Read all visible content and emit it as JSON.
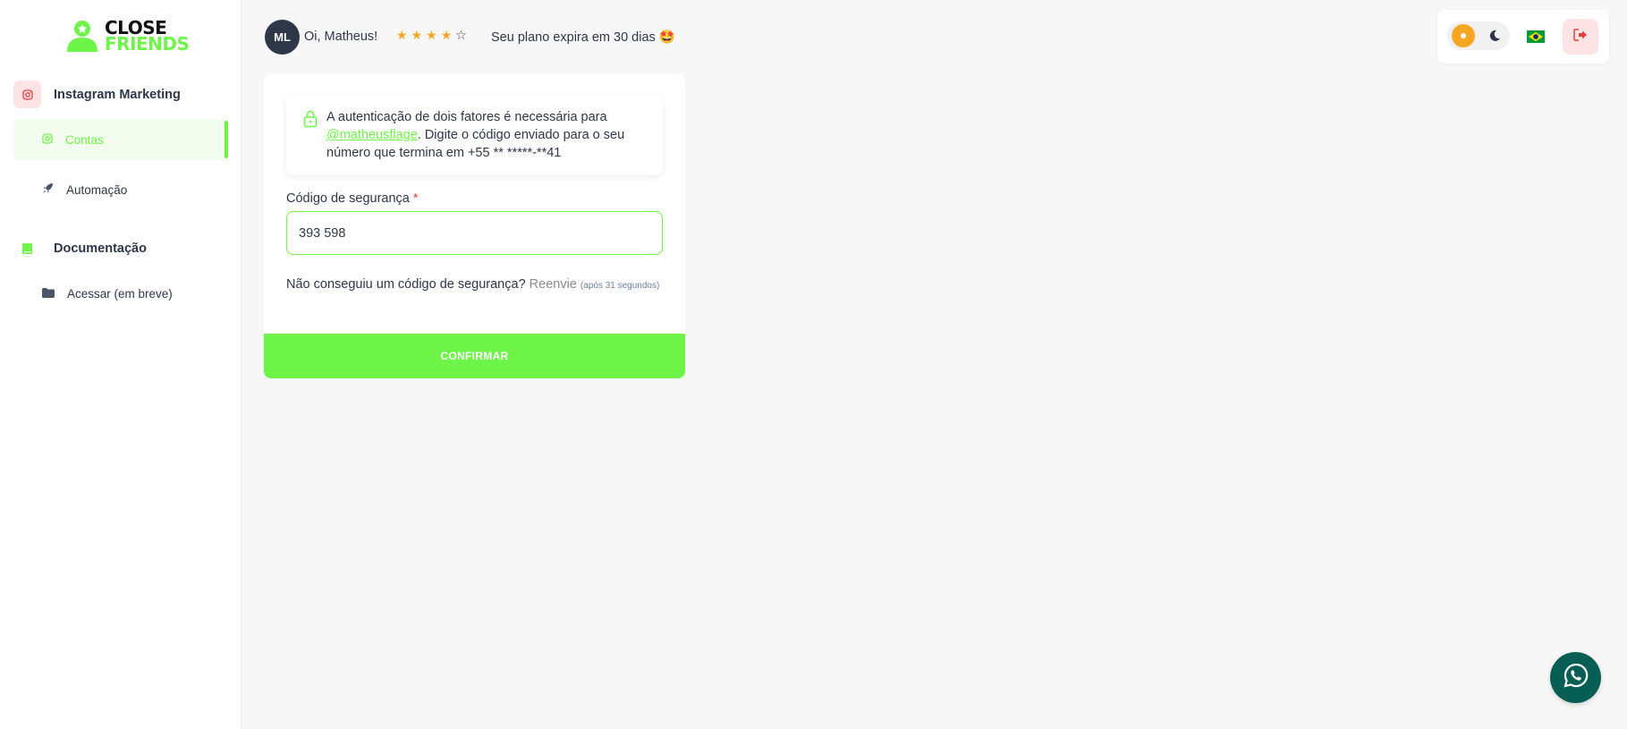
{
  "logo": {
    "line1": "CLOSE",
    "line2": "FRIENDS"
  },
  "sidebar": {
    "sections": [
      {
        "label": "Instagram Marketing",
        "icon": "instagram-icon",
        "color": "#e53e3e"
      },
      {
        "label": "Documentação",
        "icon": "book-icon",
        "color": "#6ff54a"
      }
    ],
    "items": [
      {
        "label": "Contas",
        "icon": "instagram-icon",
        "active": true
      },
      {
        "label": "Automação",
        "icon": "rocket-icon",
        "active": false
      },
      {
        "label": "Acessar (em breve)",
        "icon": "folder-icon",
        "active": false
      }
    ]
  },
  "header": {
    "avatar_initials": "ML",
    "greeting": "Oi, Matheus!",
    "rating": {
      "filled": 4,
      "total": 5
    },
    "plan_text": "Seu plano expira em 30 dias 🤩"
  },
  "top_controls": {
    "theme": "light",
    "icons": [
      "sun-icon",
      "moon-icon",
      "brazil-flag-icon",
      "logout-icon"
    ]
  },
  "two_factor": {
    "alert_prefix": "A autenticação de dois fatores é necessária para ",
    "handle": "@matheusflage",
    "alert_suffix": ". Digite o código enviado para o seu número que termina em +55 ** *****-**41",
    "field_label": "Código de segurança",
    "required_mark": "*",
    "code_value": "393 598",
    "resend_question": "Não conseguiu um código de segurança?",
    "resend_link": "Reenvie",
    "resend_timer": "(após 31 segundos)",
    "confirm_label": "CONFIRMAR"
  },
  "colors": {
    "accent": "#6ff54a",
    "danger": "#e53e3e",
    "whatsapp": "#075e54"
  }
}
